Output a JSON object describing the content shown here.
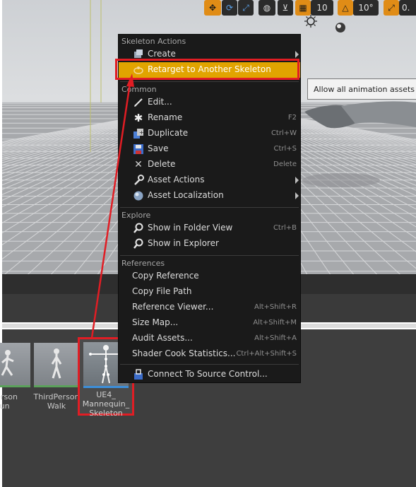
{
  "viewport": {
    "toolbar": {
      "grid_snap_value": "10",
      "rotation_snap_value": "10°",
      "scale_snap_value": "0."
    },
    "tooltip": "Allow all animation assets for"
  },
  "context_menu": {
    "skeleton_actions": {
      "header": "Skeleton Actions",
      "items": [
        {
          "label": "Create"
        },
        {
          "label": "Retarget to Another Skeleton"
        }
      ]
    },
    "common": {
      "header": "Common",
      "items": [
        {
          "label": "Edit...",
          "shortcut": ""
        },
        {
          "label": "Rename",
          "shortcut": "F2"
        },
        {
          "label": "Duplicate",
          "shortcut": "Ctrl+W"
        },
        {
          "label": "Save",
          "shortcut": "Ctrl+S"
        },
        {
          "label": "Delete",
          "shortcut": "Delete"
        },
        {
          "label": "Asset Actions",
          "shortcut": ""
        },
        {
          "label": "Asset Localization",
          "shortcut": ""
        }
      ]
    },
    "explore": {
      "header": "Explore",
      "items": [
        {
          "label": "Show in Folder View",
          "shortcut": "Ctrl+B"
        },
        {
          "label": "Show in Explorer",
          "shortcut": ""
        }
      ]
    },
    "references": {
      "header": "References",
      "items": [
        {
          "label": "Copy Reference",
          "shortcut": ""
        },
        {
          "label": "Copy File Path",
          "shortcut": ""
        },
        {
          "label": "Reference Viewer...",
          "shortcut": "Alt+Shift+R"
        },
        {
          "label": "Size Map...",
          "shortcut": "Alt+Shift+M"
        },
        {
          "label": "Audit Assets...",
          "shortcut": "Alt+Shift+A"
        },
        {
          "label": "Shader Cook Statistics...",
          "shortcut": "Ctrl+Alt+Shift+S"
        }
      ]
    },
    "source_control": {
      "label": "Connect To Source Control..."
    }
  },
  "assets": [
    {
      "label_line1": "dPerson",
      "label_line2": "Run"
    },
    {
      "label_line1": "ThirdPerson",
      "label_line2": "Walk"
    },
    {
      "label_line1": "UE4_",
      "label_line2": "Mannequin_",
      "label_line3": "Skeleton"
    }
  ],
  "colors": {
    "highlight": "#e1a400",
    "annotation": "#e11d24",
    "menu_bg": "#1a1a1a",
    "toolbar_accent": "#e08c16"
  },
  "icons": {
    "create": "create-icon",
    "retarget": "retarget-icon",
    "edit": "edit-icon",
    "rename": "rename-icon",
    "duplicate": "duplicate-icon",
    "save": "save-icon",
    "delete": "delete-icon",
    "asset_actions": "wrench-icon",
    "asset_localization": "globe-icon",
    "folder_view": "magnifier-icon",
    "explorer": "magnifier-icon",
    "source_control": "source-control-icon"
  }
}
